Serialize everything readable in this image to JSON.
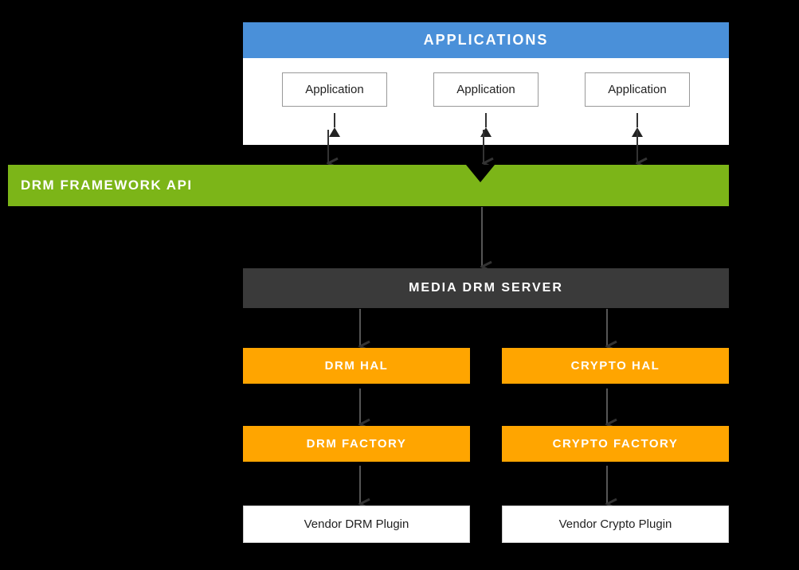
{
  "applications": {
    "header": "APPLICATIONS",
    "apps": [
      {
        "label": "Application"
      },
      {
        "label": "Application"
      },
      {
        "label": "Application"
      }
    ]
  },
  "drm_framework": {
    "label": "DRM FRAMEWORK API"
  },
  "media_drm": {
    "label": "MEDIA DRM SERVER"
  },
  "hal_row": {
    "left": "DRM HAL",
    "right": "CRYPTO HAL"
  },
  "factory_row": {
    "left": "DRM FACTORY",
    "right": "CRYPTO FACTORY"
  },
  "vendor_row": {
    "left": "Vendor DRM Plugin",
    "right": "Vendor Crypto Plugin"
  },
  "colors": {
    "bg": "#000000",
    "applications_header": "#4A90D9",
    "drm_framework": "#7CB518",
    "media_drm": "#3a3a3a",
    "hal_factory": "#FFA500",
    "vendor": "#ffffff"
  }
}
